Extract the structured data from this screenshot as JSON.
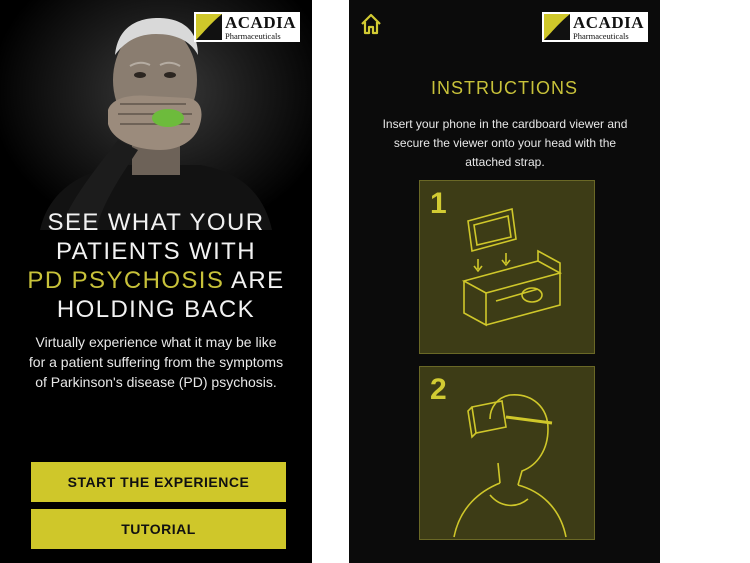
{
  "brand": {
    "name": "ACADIA",
    "registered": "®",
    "sub": "Pharmaceuticals",
    "color": "#cfc72a"
  },
  "left_screen": {
    "headline": {
      "line1": "SEE WHAT YOUR",
      "line2": "PATIENTS WITH",
      "line3_accent": "PD PSYCHOSIS",
      "line3_rest": " ARE",
      "line4": "HOLDING BACK"
    },
    "intro": "Virtually experience what it may be like for a patient suffering from the symptoms of Parkinson's disease (PD) psychosis.",
    "buttons": {
      "start": "START THE EXPERIENCE",
      "tutorial": "TUTORIAL"
    }
  },
  "right_screen": {
    "home_icon": "home-icon",
    "title": "INSTRUCTIONS",
    "instruction": "Insert your phone in the cardboard viewer and secure the viewer onto your head with the attached strap.",
    "steps": [
      {
        "number": "1",
        "icon": "phone-into-cardboard-viewer-illustration"
      },
      {
        "number": "2",
        "icon": "person-wearing-viewer-illustration"
      }
    ]
  }
}
